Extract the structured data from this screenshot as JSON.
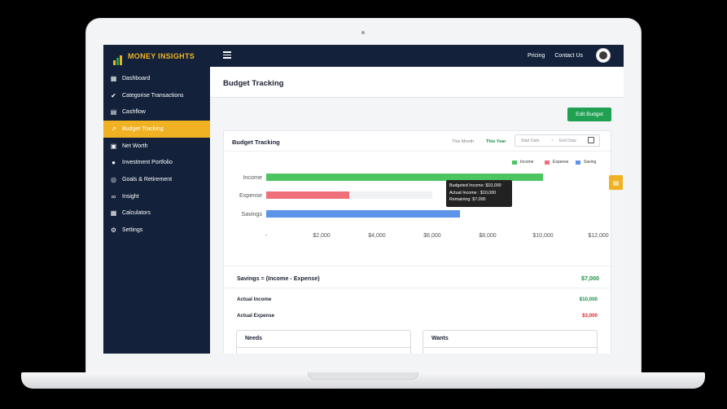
{
  "app": {
    "brand": "MONEY INSIGHTS",
    "colors": {
      "navy": "#13213b",
      "accent": "#f0b122",
      "green": "#20a152"
    }
  },
  "topnav": {
    "links": [
      "Pricing",
      "Contact Us"
    ]
  },
  "sidebar": {
    "items": [
      {
        "label": "Dashboard",
        "icon": "grid-icon",
        "active": false
      },
      {
        "label": "Categorise Transactions",
        "icon": "check-circle-icon",
        "active": false
      },
      {
        "label": "Cashflow",
        "icon": "document-icon",
        "active": false
      },
      {
        "label": "Budget Tracking",
        "icon": "trend-line-icon",
        "active": true
      },
      {
        "label": "Net Worth",
        "icon": "calendar-icon",
        "active": false
      },
      {
        "label": "Investment Portfolio",
        "icon": "money-bag-icon",
        "active": false
      },
      {
        "label": "Goals & Retirement",
        "icon": "target-icon",
        "active": false
      },
      {
        "label": "Insight",
        "icon": "binoculars-icon",
        "active": false
      },
      {
        "label": "Calculators",
        "icon": "calculator-icon",
        "active": false
      },
      {
        "label": "Settings",
        "icon": "gear-icon",
        "active": false
      }
    ]
  },
  "page": {
    "title": "Budget Tracking",
    "edit_button": "Edit Budget"
  },
  "card": {
    "title": "Budget Tracking",
    "period_month": "This Month",
    "period_year": "This Year",
    "start_placeholder": "Start Date",
    "end_placeholder": "End Date",
    "date_sep": "~"
  },
  "legend": {
    "income": "Income",
    "expense": "Expense",
    "saving": "Saving"
  },
  "tooltip": {
    "line1": "Budgeted Income: $10,000",
    "line2": "Actual Income : $10,000",
    "line3": "Remaining: $7,000"
  },
  "chart_data": {
    "type": "bar",
    "orientation": "horizontal",
    "categories": [
      "Income",
      "Expense",
      "Savings"
    ],
    "series": [
      {
        "name": "Income",
        "values": [
          10000,
          3000,
          7000
        ]
      }
    ],
    "budget_values": [
      10000,
      6000,
      null
    ],
    "colors": [
      "#4cc560",
      "#ef6f7a",
      "#5b94e8"
    ],
    "xticks": [
      "-",
      "$2,000",
      "$4,000",
      "$6,000",
      "$8,000",
      "$10,000",
      "$12,000"
    ],
    "xlim": [
      0,
      12000
    ],
    "legend_position": "top-right"
  },
  "summary": {
    "savings_label": "Savings = (Income - Expense)",
    "savings_value": "$7,000",
    "actual_income_label": "Actual Income",
    "actual_income_value": "$10,000",
    "actual_expense_label": "Actual Expense",
    "actual_expense_value": "$3,000"
  },
  "boxes": {
    "needs": "Needs",
    "wants": "Wants"
  }
}
